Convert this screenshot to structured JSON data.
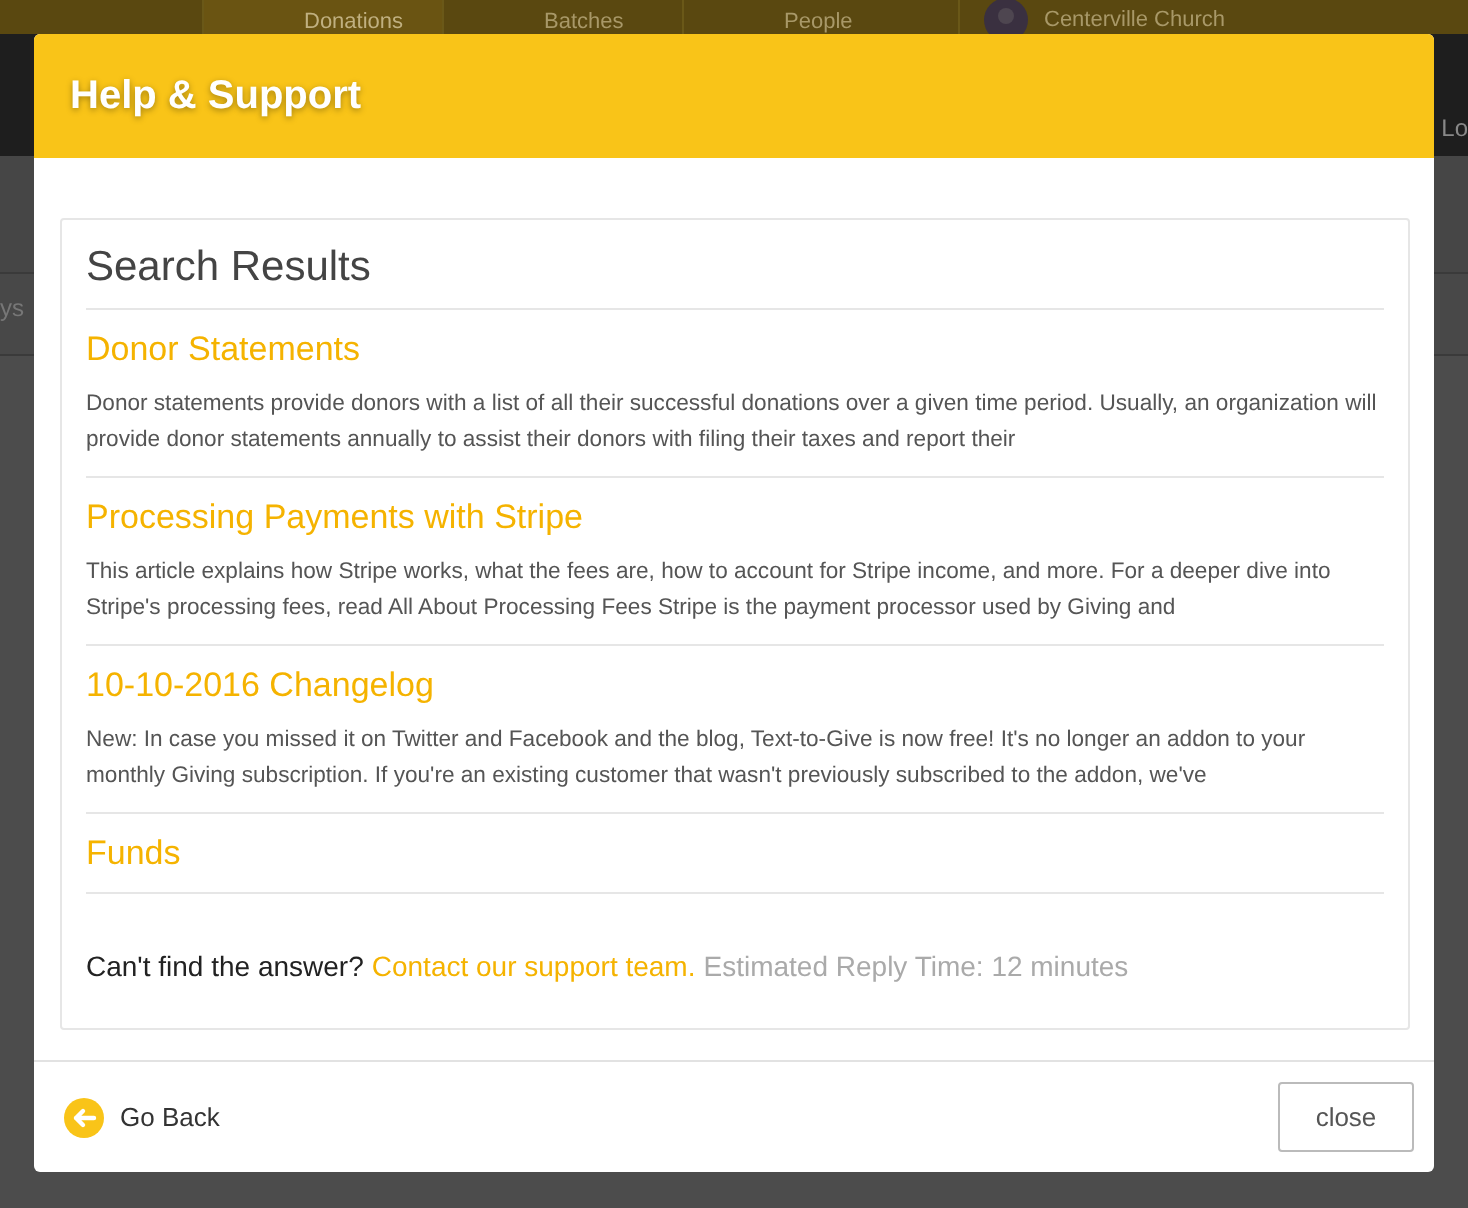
{
  "backdrop": {
    "tabs": [
      {
        "label": "Donations",
        "selected": true
      },
      {
        "label": "Batches",
        "selected": false
      },
      {
        "label": "People",
        "selected": false
      }
    ],
    "account": "Centerville Church",
    "side_text_right": "Lo",
    "side_text_left": "ys"
  },
  "dialog": {
    "title": "Help & Support",
    "heading": "Search Results",
    "results": [
      {
        "title": "Donor Statements",
        "excerpt": "Donor statements provide donors with a list of all their successful donations over a given time period. Usually, an organization will provide donor statements annually to assist their donors with filing their taxes and report their"
      },
      {
        "title": "Processing Payments with Stripe",
        "excerpt": "This article explains how Stripe works, what the fees are, how to account for Stripe income, and more. For a deeper dive into Stripe's processing fees, read All About Processing Fees Stripe is the payment processor used by Giving and"
      },
      {
        "title": "10-10-2016 Changelog",
        "excerpt": "New: In case you missed it on Twitter and Facebook and the blog, Text-to-Give is now free! It's no longer an addon to your monthly Giving subscription. If you're an existing customer that wasn't previously subscribed to the addon, we've"
      },
      {
        "title": "Funds"
      }
    ],
    "footer_prompt": "Can't find the answer?",
    "contact_link": "Contact our support team.",
    "reply_time": "Estimated Reply Time: 12 minutes",
    "back_label": "Go Back",
    "close_label": "close"
  }
}
